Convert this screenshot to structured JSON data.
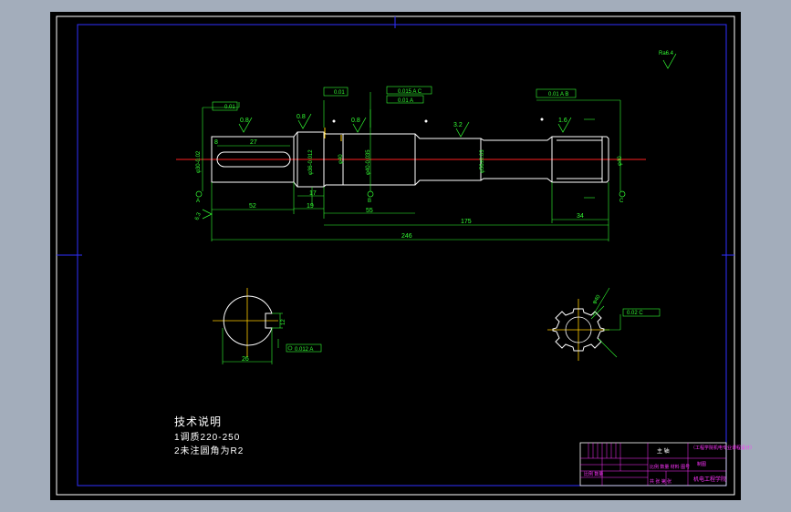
{
  "notes": {
    "title": "技术说明",
    "line1": "1调质220-250",
    "line2": "2未注圆角为R2"
  },
  "dimensions": {
    "d_52": "52",
    "d_19": "19",
    "d_55": "55",
    "d_175": "175",
    "d_246": "246",
    "d_34": "34",
    "d_27": "27",
    "d_8": "8",
    "d_17": "17",
    "d_26": "26",
    "d_12": "12",
    "dia1": "φ30-0.02",
    "dia2": "φ36-0.012",
    "dia3": "φ40",
    "dia4": "φ40-0.035",
    "dia5": "φ56±0.03",
    "dia6": "φ40",
    "rough_left": "6.3",
    "rough1": "0.8",
    "rough2": "0.8",
    "rough3": "0.8",
    "rough4": "3.2",
    "rough5": "1.6",
    "rough_global": "Ra6.4"
  },
  "tolerances": {
    "t1": "0.01",
    "t2": "0.01",
    "t3a": "0.015 A C",
    "t3b": "0.01 A",
    "t4": "0.01 A B",
    "t5": "0.012 A",
    "t6": "0.02 C"
  },
  "datums": {
    "a": "A",
    "b": "B",
    "c": "C"
  },
  "title_block": {
    "name": "主 轴",
    "school": "机电工程学院",
    "top_right": "（工程学院机电专业课程设计）",
    "sub": "制图",
    "left1": "比例 数量 材料 图号",
    "left2": "比例 数量",
    "bottom": "共 张 第 张"
  },
  "colors": {
    "border": "#2f2fff",
    "geometry": "#ffffff",
    "dim": "#33ff33",
    "center": "#ff2020",
    "frame": "#ff33ff"
  }
}
